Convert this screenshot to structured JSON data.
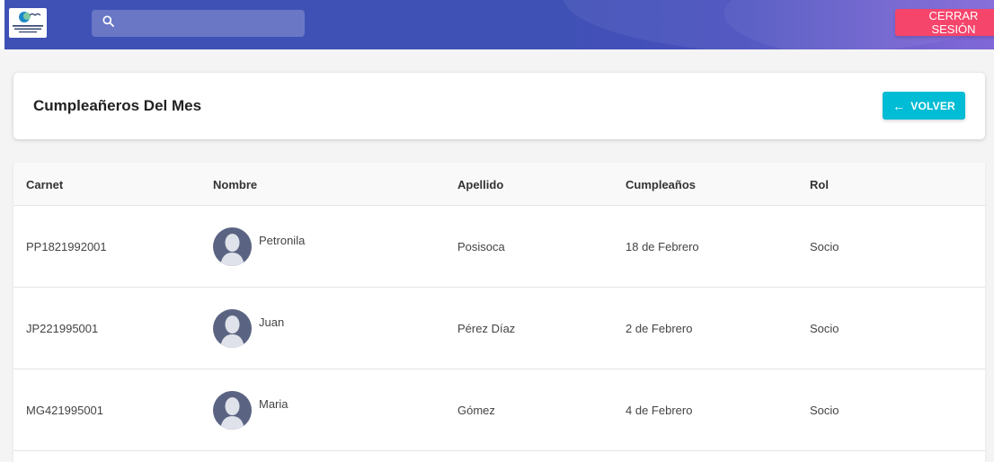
{
  "header": {
    "search_placeholder": "",
    "logout_label": "CERRAR SESIÓN"
  },
  "page": {
    "title": "Cumpleañeros Del Mes",
    "back_label": "VOLVER"
  },
  "table": {
    "columns": [
      "Carnet",
      "Nombre",
      "Apellido",
      "Cumpleaños",
      "Rol"
    ],
    "rows": [
      {
        "carnet": "PP1821992001",
        "nombre": "Petronila",
        "apellido": "Posisoca",
        "cumpleanos": "18 de Febrero",
        "rol": "Socio"
      },
      {
        "carnet": "JP221995001",
        "nombre": "Juan",
        "apellido": "Pérez Díaz",
        "cumpleanos": "2 de Febrero",
        "rol": "Socio"
      },
      {
        "carnet": "MG421995001",
        "nombre": "Maria",
        "apellido": "Gómez",
        "cumpleanos": "4 de Febrero",
        "rol": "Socio"
      }
    ]
  },
  "icons": {
    "search": "search-icon",
    "back": "arrow-left-icon",
    "avatar": "user-avatar-icon"
  },
  "colors": {
    "topbar": "#3f51b5",
    "logout": "#f5456b",
    "back": "#00bcd4"
  }
}
